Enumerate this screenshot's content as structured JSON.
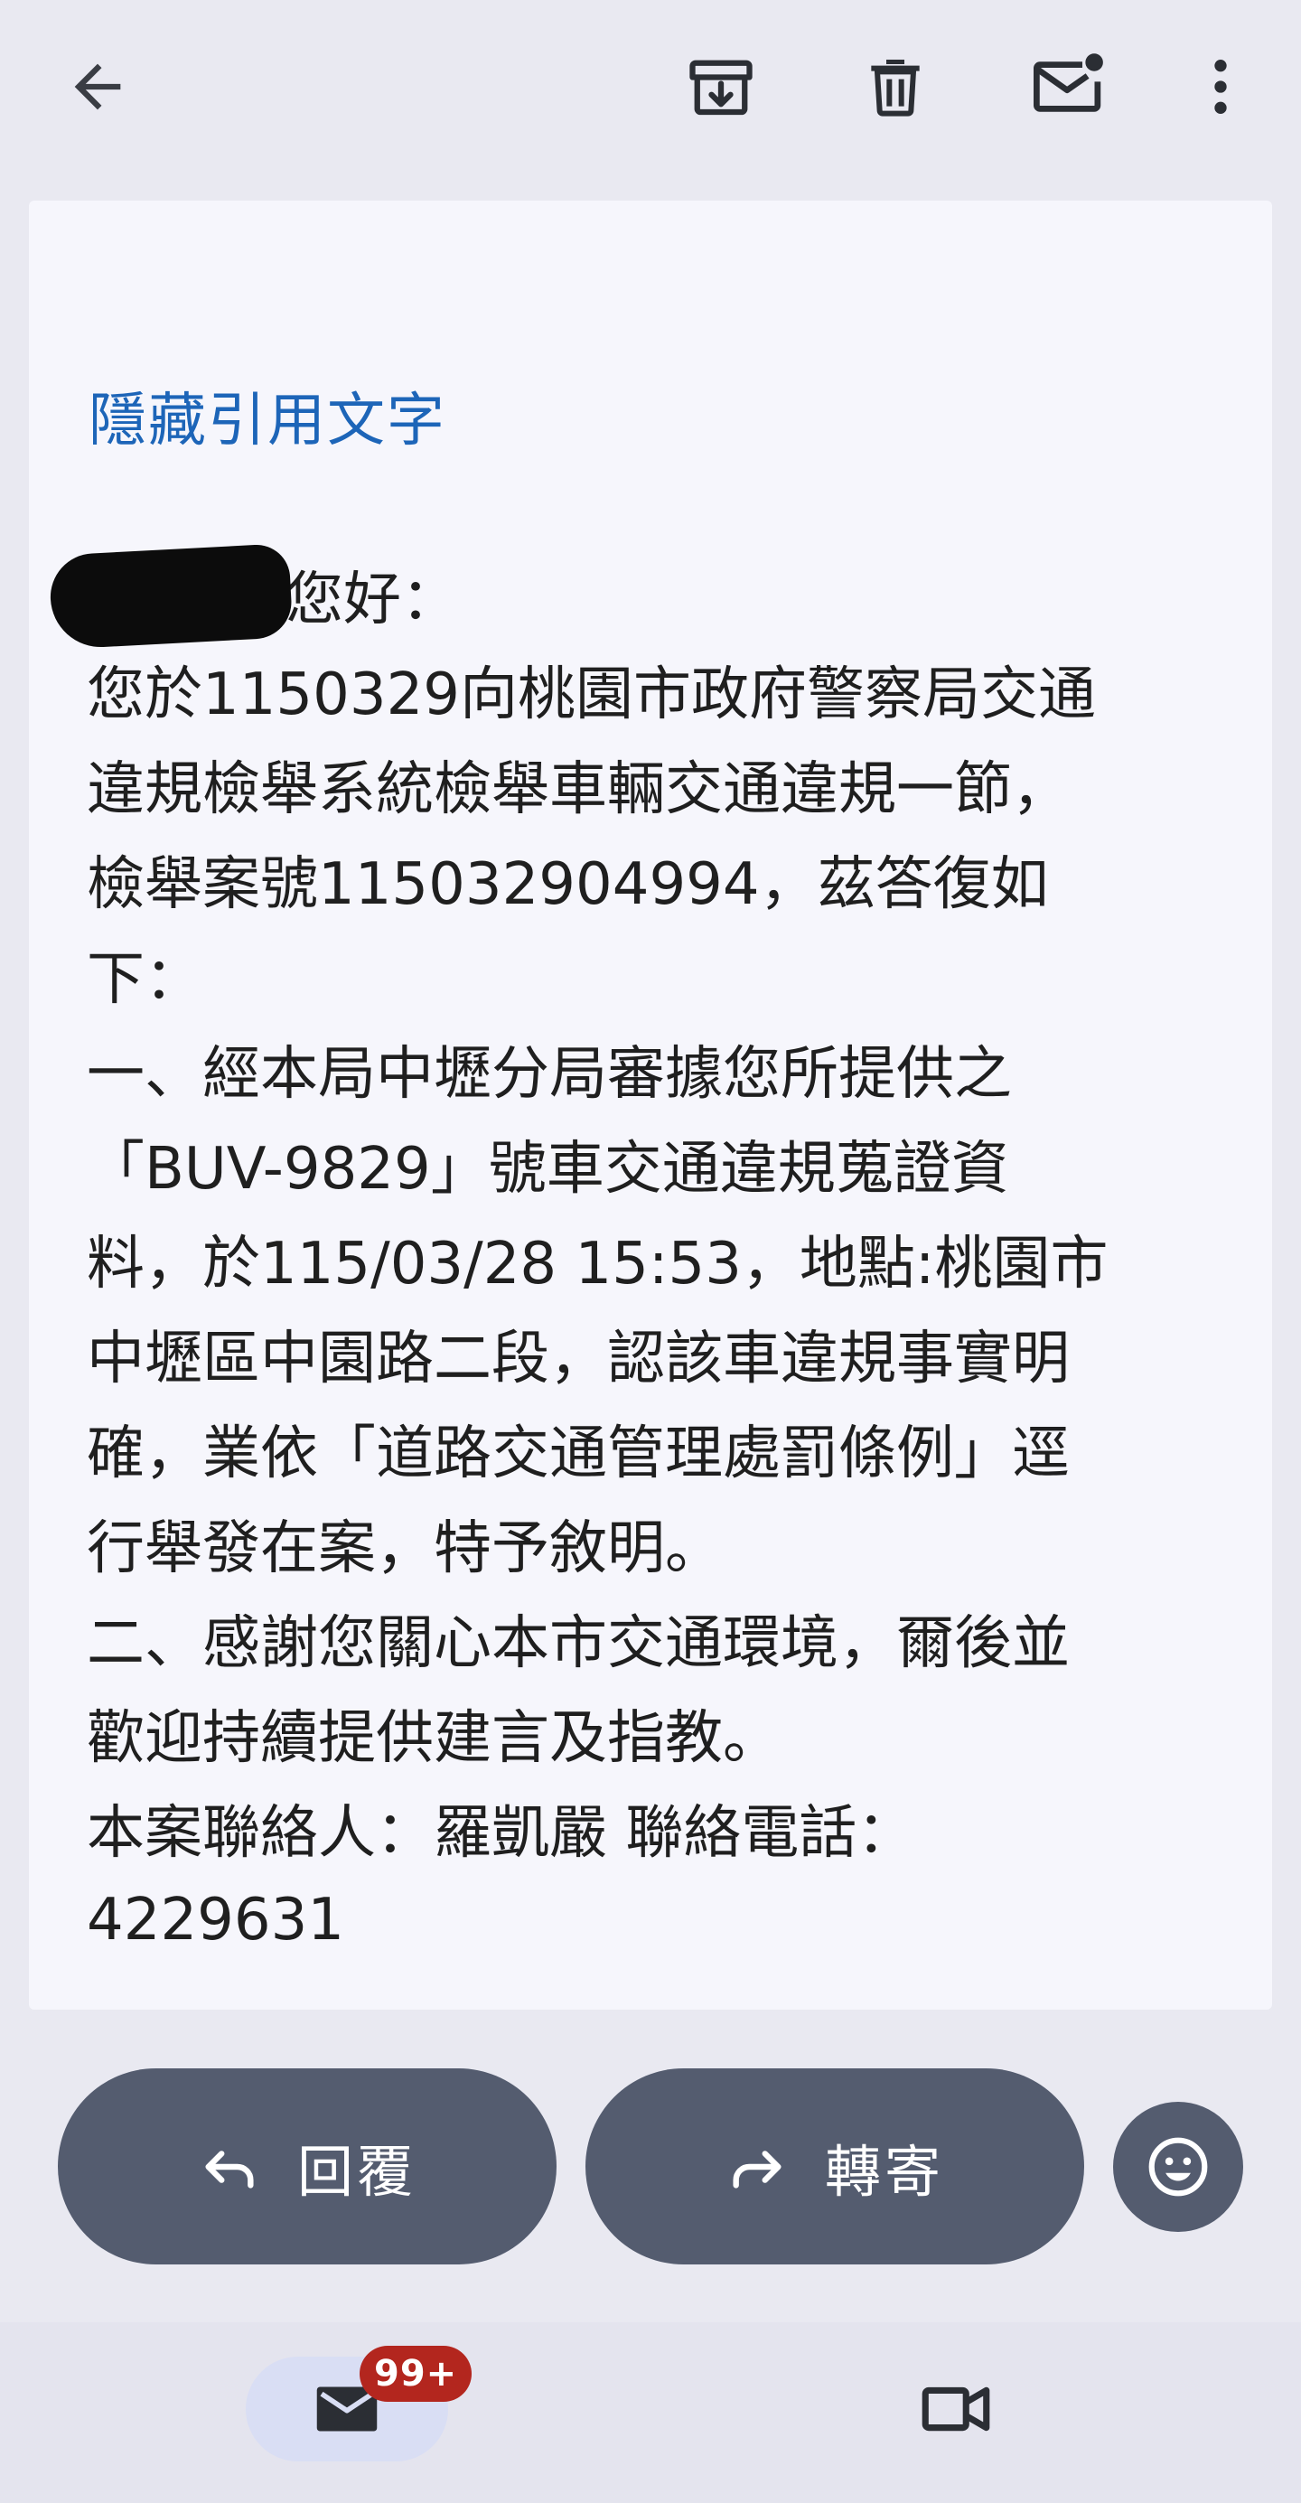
{
  "toolbar": {
    "back_icon": "arrow-back-icon",
    "archive_icon": "archive-icon",
    "delete_icon": "trash-icon",
    "mark_unread_icon": "mail-unread-icon",
    "more_icon": "more-vert-icon"
  },
  "message": {
    "hide_quoted_label": "隱藏引用文字",
    "lines": [
      "您好：",
      "您於1150329向桃園市政府警察局交通",
      "違規檢舉系統檢舉車輛交通違規一節，",
      "檢舉案號115032904994，茲答復如",
      "下：",
      "一、經本局中壢分局審據您所提供之",
      "「BUV-9829」號車交通違規蒐證資",
      "料，於115/03/28 15:53，地點:桃園市",
      "中壢區中園路二段，認該車違規事實明",
      "確，業依「道路交通管理處罰條例」逕",
      "行舉發在案，特予敘明。",
      "二、感謝您關心本市交通環境，爾後並",
      "歡迎持續提供建言及指教。",
      "本案聯絡人：羅凱嚴 聯絡電話：",
      "4229631"
    ]
  },
  "actions": {
    "reply_label": "回覆",
    "forward_label": "轉寄",
    "emoji_icon": "emoji-icon"
  },
  "bottom_nav": {
    "mail_icon": "mail-icon",
    "badge": "99+",
    "meet_icon": "video-camera-icon"
  },
  "colors": {
    "background": "#e9e9f1",
    "card": "#f6f6fc",
    "link": "#1d65b8",
    "button": "#545c6f",
    "badge": "#b3261e",
    "nav_active": "#d9def4"
  }
}
